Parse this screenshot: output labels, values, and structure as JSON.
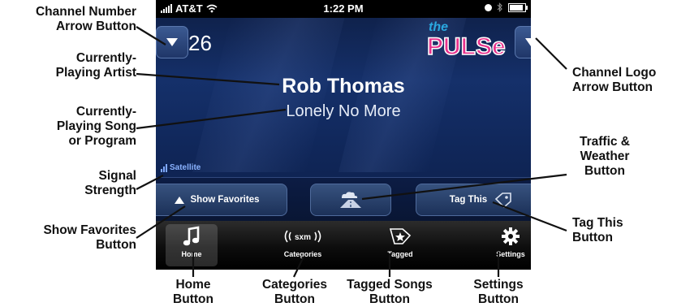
{
  "status_bar": {
    "carrier": "AT&T",
    "time": "1:22 PM"
  },
  "channel": {
    "number": "26",
    "logo_top": "the",
    "logo_main": "PULSe"
  },
  "now_playing": {
    "artist": "Rob Thomas",
    "song": "Lonely No More"
  },
  "signal": {
    "label": "Satellite",
    "level": 3
  },
  "buttons": {
    "show_favorites": "Show Favorites",
    "tag_this": "Tag This"
  },
  "tabs": [
    "Home",
    "Categories",
    "Tagged",
    "Settings"
  ],
  "callouts": {
    "channel_number_arrow": [
      "Channel Number",
      "Arrow Button"
    ],
    "current_artist": [
      "Currently-",
      "Playing Artist"
    ],
    "current_song": [
      "Currently-",
      "Playing Song",
      "or Program"
    ],
    "signal_strength": [
      "Signal",
      "Strength"
    ],
    "show_favorites": [
      "Show Favorites",
      "Button"
    ],
    "channel_logo_arrow": [
      "Channel Logo",
      "Arrow Button"
    ],
    "traffic_weather": [
      "Traffic &",
      "Weather",
      "Button"
    ],
    "tag_this": [
      "Tag This",
      "Button"
    ],
    "home": [
      "Home",
      "Button"
    ],
    "categories": [
      "Categories",
      "Button"
    ],
    "tagged_songs": [
      "Tagged Songs",
      "Button"
    ],
    "settings": [
      "Settings",
      "Button"
    ]
  },
  "colors": {
    "screen": "#15306a",
    "signal": "#8ab3ff",
    "logo_pink": "#e8318c",
    "logo_orange": "#f39a1e",
    "logo_blue": "#2aa8e0"
  }
}
